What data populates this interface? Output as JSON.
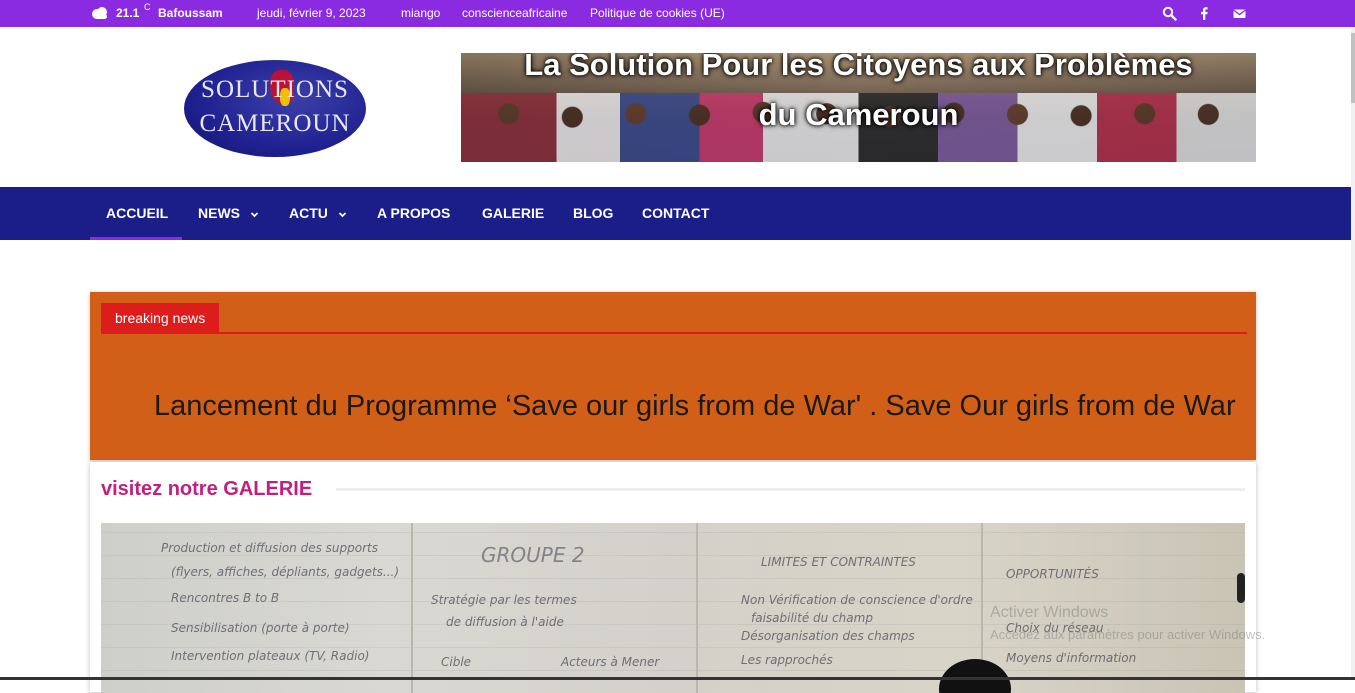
{
  "topbar": {
    "temperature": "21.1",
    "temp_unit": "C",
    "city": "Bafoussam",
    "date": "jeudi, février 9, 2023",
    "links": [
      "miango",
      "conscienceafricaine",
      "Politique de cookies (UE)"
    ],
    "icons": [
      "search-icon",
      "facebook-icon",
      "mail-icon"
    ],
    "bg_color": "#8a2be2"
  },
  "header": {
    "logo_line1": "SOLUTIONS",
    "logo_line2": "CAMEROUN",
    "banner_line1": "La Solution Pour les Citoyens aux Problèmes",
    "banner_line2": "du Cameroun"
  },
  "nav": {
    "items": [
      {
        "label": "ACCUEIL"
      },
      {
        "label": "NEWS"
      },
      {
        "label": "ACTU"
      },
      {
        "label": "A PROPOS"
      },
      {
        "label": "GALERIE"
      },
      {
        "label": "BLOG"
      },
      {
        "label": "CONTACT"
      }
    ],
    "bg_color": "#1b1e88"
  },
  "breaking": {
    "tag": "breaking news",
    "ticker": "Lancement du Programme ‘Save our girls from de War' . Save Our girls from de War",
    "bg_color": "#d25f18",
    "accent": "#dd1c1c"
  },
  "gallery": {
    "title": "visitez notre GALERIE",
    "title_color": "#c21f7f",
    "photo_text": {
      "groupe": "GROUPE 2",
      "c1a": "Production et diffusion des supports",
      "c1b": "(flyers, affiches, dépliants, gadgets...)",
      "c1c": "Rencontres B to B",
      "c1d": "Sensibilisation (porte à porte)",
      "c1e": "Intervention plateaux (TV, Radio)",
      "c2a": "Stratégie par les termes",
      "c2b": "de diffusion à l'aide",
      "c2c": "Cible",
      "c2d": "Acteurs à Mener",
      "c3a": "LIMITES ET CONTRAINTES",
      "c3b": "Non Vérification de conscience d'ordre",
      "c3c": "faisabilité du champ",
      "c3d": "Désorganisation des champs",
      "c3e": "Les rapprochés",
      "c4a": "OPPORTUNITÉS",
      "c4b": "Choix du réseau",
      "c4c": "Moyens d'information"
    }
  },
  "watermark": {
    "line1": "Activer Windows",
    "line2": "Accédez aux paramètres pour activer Windows."
  }
}
